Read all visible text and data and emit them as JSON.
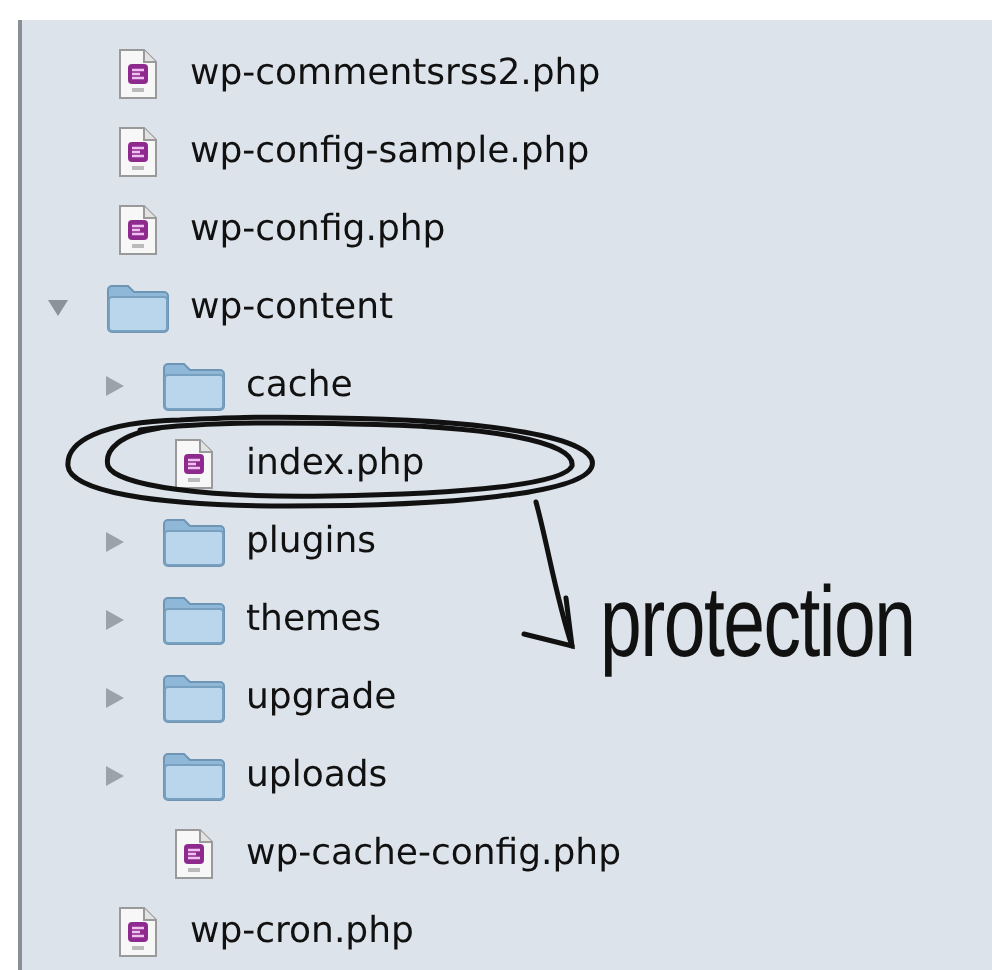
{
  "items": [
    {
      "kind": "file",
      "name": "wp-commentsrss2.php"
    },
    {
      "kind": "file",
      "name": "wp-config-sample.php"
    },
    {
      "kind": "file",
      "name": "wp-config.php"
    },
    {
      "kind": "folder",
      "name": "wp-content",
      "expanded": true,
      "children": [
        {
          "kind": "folder",
          "name": "cache",
          "expanded": false
        },
        {
          "kind": "file",
          "name": "index.php"
        },
        {
          "kind": "folder",
          "name": "plugins",
          "expanded": false
        },
        {
          "kind": "folder",
          "name": "themes",
          "expanded": false
        },
        {
          "kind": "folder",
          "name": "upgrade",
          "expanded": false
        },
        {
          "kind": "folder",
          "name": "uploads",
          "expanded": false
        },
        {
          "kind": "file",
          "name": "wp-cache-config.php"
        }
      ]
    },
    {
      "kind": "file",
      "name": "wp-cron.php"
    }
  ],
  "annotation": {
    "label": "protection"
  }
}
